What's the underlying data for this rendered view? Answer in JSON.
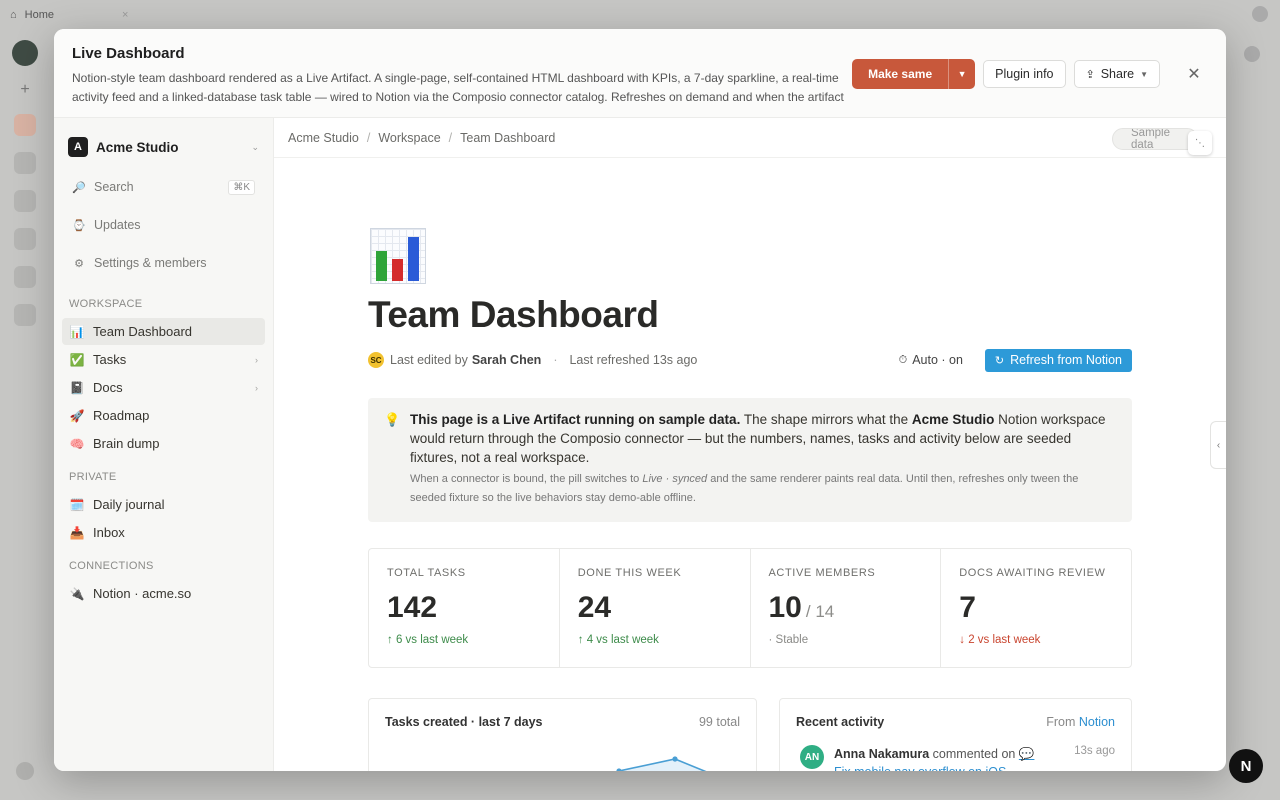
{
  "background": {
    "tab_label": "Home"
  },
  "modal": {
    "title": "Live Dashboard",
    "description": "Notion-style team dashboard rendered as a Live Artifact. A single-page, self-contained HTML dashboard with KPIs, a 7-day sparkline, a real-time activity feed and a linked-database task table — wired to Notion via the Composio connector catalog. Refreshes on demand and when the artifact i…",
    "actions": {
      "make_same": "Make same",
      "plugin_info": "Plugin info",
      "share": "Share"
    }
  },
  "sidebar": {
    "workspace": {
      "logo_letter": "A",
      "name": "Acme Studio"
    },
    "search": {
      "label": "Search",
      "shortcut": "⌘K"
    },
    "updates": "Updates",
    "settings": "Settings & members",
    "sections": {
      "workspace": "WORKSPACE",
      "private": "PRIVATE",
      "connections": "CONNECTIONS"
    },
    "workspace_items": [
      {
        "emoji": "📊",
        "label": "Team Dashboard",
        "active": true
      },
      {
        "emoji": "✅",
        "label": "Tasks"
      },
      {
        "emoji": "📓",
        "label": "Docs"
      },
      {
        "emoji": "🚀",
        "label": "Roadmap"
      },
      {
        "emoji": "🧠",
        "label": "Brain dump"
      }
    ],
    "private_items": [
      {
        "emoji": "🗓️",
        "label": "Daily journal"
      },
      {
        "emoji": "📥",
        "label": "Inbox"
      }
    ],
    "connection_items": [
      {
        "emoji": "🔌",
        "label": "Notion · acme.so"
      }
    ]
  },
  "breadcrumb": [
    "Acme Studio",
    "Workspace",
    "Team Dashboard"
  ],
  "sample_pill": "Sample data",
  "page": {
    "title": "Team Dashboard",
    "meta": {
      "avatar_initials": "SC",
      "edited_prefix": "Last edited by",
      "editor": "Sarah Chen",
      "refreshed": "Last refreshed 13s ago",
      "auto": "Auto · on",
      "refresh_button": "Refresh from Notion"
    },
    "callout": {
      "lead_bold": "This page is a Live Artifact running on sample data.",
      "lead_1": " The shape mirrors what the ",
      "lead_ws": "Acme Studio",
      "lead_2": " Notion workspace would return through the Composio connector — but the numbers, names, tasks and activity below are seeded fixtures, not a real workspace.",
      "sub_1": "When a connector is bound, the pill switches to ",
      "sub_live": "Live · synced",
      "sub_2": " and the same renderer paints real data. Until then, refreshes only tween the seeded fixture so the live behaviors stay demo-able offline."
    },
    "kpis": [
      {
        "label": "TOTAL TASKS",
        "value": "142",
        "of": "",
        "delta": "↑ 6 vs last week",
        "trend": "up"
      },
      {
        "label": "DONE THIS WEEK",
        "value": "24",
        "of": "",
        "delta": "↑ 4 vs last week",
        "trend": "up"
      },
      {
        "label": "ACTIVE MEMBERS",
        "value": "10",
        "of": "/ 14",
        "delta": "· Stable",
        "trend": "neutral"
      },
      {
        "label": "DOCS AWAITING REVIEW",
        "value": "7",
        "of": "",
        "delta": "↓ 2 vs last week",
        "trend": "down"
      }
    ],
    "chart_card": {
      "title": "Tasks created · last 7 days",
      "total": "99 total"
    },
    "activity_card": {
      "title": "Recent activity",
      "from_prefix": "From",
      "from_link": "Notion",
      "items": [
        {
          "initials": "AN",
          "name": "Anna Nakamura",
          "action": "commented on",
          "target": "💬 Fix mobile nav overflow on iOS",
          "time": "13s ago"
        }
      ]
    }
  },
  "colors": {
    "accent": "#c8583b",
    "refresh": "#2d9ad8",
    "up": "#3d8b4a",
    "down": "#c9452f",
    "spark": "#4a9fd4"
  },
  "fab_letter": "N"
}
